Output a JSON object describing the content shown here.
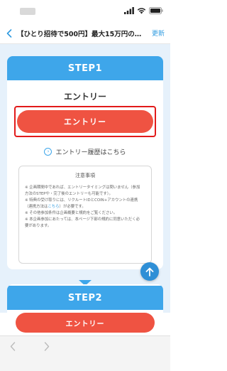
{
  "nav": {
    "back_icon": "chevron-left-icon",
    "title": "【ひとり招待で500円】最大15万円の…",
    "refresh_label": "更新"
  },
  "step1": {
    "header": "STEP1",
    "entry_heading": "エントリー",
    "entry_button": "エントリー",
    "history_link": "エントリー履歴はこちら",
    "notes": {
      "title": "注意事項",
      "lines": [
        "※ 企画期間中であれば、エントリータイミングは問いません（参加",
        "方法のSTEPや・完了後のエントリーも可能です）。",
        "※ 特典の受け取りには、リクルートIDとCOIN+アカウントの連携",
        "（連携方法は",
        "こちら",
        "）が必要です。",
        "※ その他参加条件は企画概要と規約をご覧ください。",
        "※ 本企画参加にあたっては、本ページ下部の規約に同意いただく必",
        "要があります。"
      ]
    }
  },
  "step2": {
    "header": "STEP2"
  },
  "bottom_bar": {
    "entry_button": "エントリー"
  },
  "colors": {
    "accent_blue": "#3ea6ea",
    "entry_red": "#ef5342",
    "highlight_red": "#e21a1a",
    "background": "#e6f1fb"
  }
}
